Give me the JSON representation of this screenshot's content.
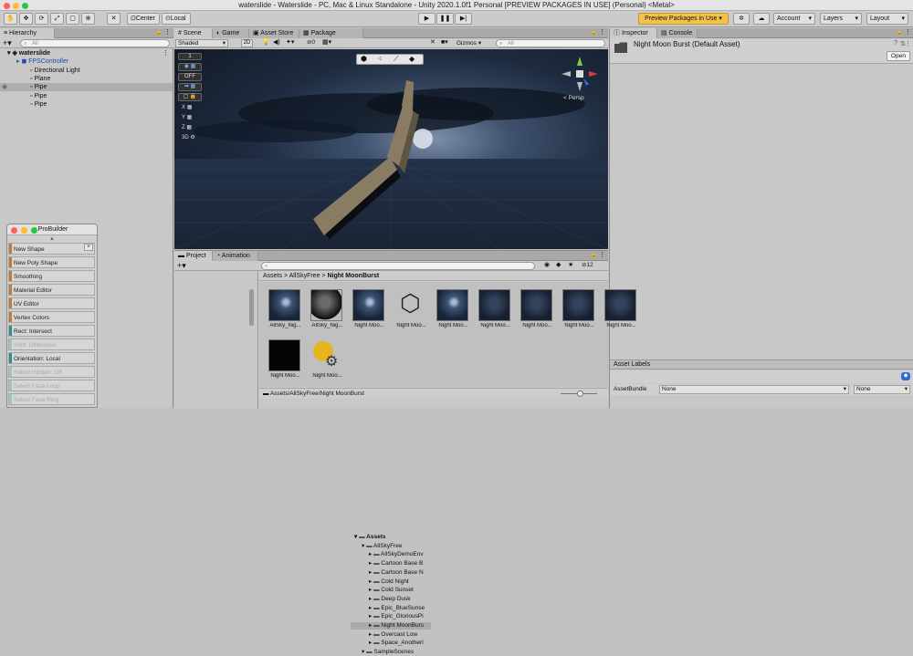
{
  "window": {
    "title": "waterslide - Waterslide - PC, Mac & Linux Standalone - Unity 2020.1.0f1 Personal [PREVIEW PACKAGES IN USE] (Personal) <Metal>"
  },
  "toolbar": {
    "pivot_label": "Center",
    "space_label": "Local",
    "preview_packages": "Preview Packages in Use",
    "account": "Account",
    "layers": "Layers",
    "layout": "Layout"
  },
  "hierarchy": {
    "tab": "Hierarchy",
    "search_placeholder": "All",
    "scene": "waterslide",
    "items": [
      "FPSController",
      "Directional Light",
      "Plane",
      "Pipe",
      "Pipe",
      "Pipe"
    ]
  },
  "scene": {
    "tabs": [
      "Scene",
      "Game",
      "Asset Store",
      "Package Manager"
    ],
    "shading": "Shaded",
    "mode_2d": "2D",
    "fx_count": "0",
    "gizmos": "Gizmos",
    "search_placeholder": "All",
    "persp_label": "< Persp",
    "side_tools": [
      "1",
      "OFF",
      "X",
      "Y",
      "Z",
      "3D"
    ]
  },
  "inspector": {
    "tabs": [
      "Inspector",
      "Console"
    ],
    "asset_name": "Night Moon Burst (Default Asset)",
    "open_button": "Open",
    "asset_labels": "Asset Labels",
    "assetbundle_label": "AssetBundle",
    "assetbundle_value": "None",
    "variant_value": "None"
  },
  "probuilder": {
    "title": "ProBuilder",
    "buttons": [
      {
        "label": "New Shape",
        "color": "#c07a3c",
        "enabled": true
      },
      {
        "label": "New Poly Shape",
        "color": "#c07a3c",
        "enabled": true
      },
      {
        "label": "Smoothing",
        "color": "#c07a3c",
        "enabled": true
      },
      {
        "label": "Material Editor",
        "color": "#c07a3c",
        "enabled": true
      },
      {
        "label": "UV Editor",
        "color": "#c07a3c",
        "enabled": true
      },
      {
        "label": "Vertex Colors",
        "color": "#c07a3c",
        "enabled": true
      },
      {
        "label": "Rect: Intersect",
        "color": "#2f8f8a",
        "enabled": true
      },
      {
        "label": "Shift: Difference",
        "color": "#9ac8c6",
        "enabled": false
      },
      {
        "label": "Orientation: Local",
        "color": "#2f8f8a",
        "enabled": true
      },
      {
        "label": "Select Hidden: Off",
        "color": "#9ac8c6",
        "enabled": false
      },
      {
        "label": "Select Face Loop",
        "color": "#9ac8c6",
        "enabled": false
      },
      {
        "label": "Select Face Ring",
        "color": "#9ac8c6",
        "enabled": false
      }
    ]
  },
  "project": {
    "tabs": [
      "Project",
      "Animation"
    ],
    "asset_count": "12",
    "breadcrumb": [
      "Assets",
      "AllSkyFree",
      "Night MoonBurst"
    ],
    "tree": [
      {
        "label": "Assets",
        "indent": 0,
        "bold": true,
        "selected": false
      },
      {
        "label": "AllSkyFree",
        "indent": 1,
        "bold": false,
        "selected": false
      },
      {
        "label": "AllSkyDemoEnv",
        "indent": 2,
        "bold": false,
        "selected": false
      },
      {
        "label": "Cartoon Base B",
        "indent": 2,
        "bold": false,
        "selected": false
      },
      {
        "label": "Cartoon Base N",
        "indent": 2,
        "bold": false,
        "selected": false
      },
      {
        "label": "Cold Night",
        "indent": 2,
        "bold": false,
        "selected": false
      },
      {
        "label": "Cold Sunset",
        "indent": 2,
        "bold": false,
        "selected": false
      },
      {
        "label": "Deep Dusk",
        "indent": 2,
        "bold": false,
        "selected": false
      },
      {
        "label": "Epic_BlueSunse",
        "indent": 2,
        "bold": false,
        "selected": false
      },
      {
        "label": "Epic_GloriousPi",
        "indent": 2,
        "bold": false,
        "selected": false
      },
      {
        "label": "Night MoonBurs",
        "indent": 2,
        "bold": false,
        "selected": true
      },
      {
        "label": "Overcast Low",
        "indent": 2,
        "bold": false,
        "selected": false
      },
      {
        "label": "Space_Anotherl",
        "indent": 2,
        "bold": false,
        "selected": false
      },
      {
        "label": "SampleScenes",
        "indent": 1,
        "bold": false,
        "selected": false
      }
    ],
    "assets": [
      {
        "label": "AllSky_Nig...",
        "kind": "sky"
      },
      {
        "label": "AllSky_Nig...",
        "kind": "sphere"
      },
      {
        "label": "Night Moo...",
        "kind": "sky"
      },
      {
        "label": "Night Moo...",
        "kind": "unity"
      },
      {
        "label": "Night Moo...",
        "kind": "sky"
      },
      {
        "label": "Night Moo...",
        "kind": "dark"
      },
      {
        "label": "Night Moo...",
        "kind": "dark"
      },
      {
        "label": "Night Moo...",
        "kind": "dark"
      },
      {
        "label": "Night Moo...",
        "kind": "dark"
      },
      {
        "label": "Night Moo...",
        "kind": "black"
      },
      {
        "label": "Night Moo...",
        "kind": "settings"
      }
    ],
    "footer_path": "Assets/AllSkyFree/Night MoonBurst"
  }
}
